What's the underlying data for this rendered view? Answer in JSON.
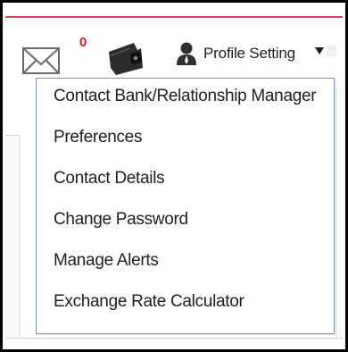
{
  "header": {
    "mail_badge_count": "0",
    "profile_label": "Profile Setting",
    "icons": {
      "mail": "mail-icon",
      "wallet": "wallet-icon",
      "person": "person-icon",
      "caret": "caret-down-icon"
    }
  },
  "colors": {
    "accent_line": "#d04a4a",
    "badge": "#e21b1b",
    "dropdown_border": "#7895c0"
  },
  "menu": {
    "items": [
      {
        "label": "Contact Bank/Relationship Manager"
      },
      {
        "label": "Preferences"
      },
      {
        "label": "Contact Details"
      },
      {
        "label": "Change Password"
      },
      {
        "label": "Manage Alerts"
      },
      {
        "label": "Exchange Rate Calculator"
      }
    ]
  }
}
